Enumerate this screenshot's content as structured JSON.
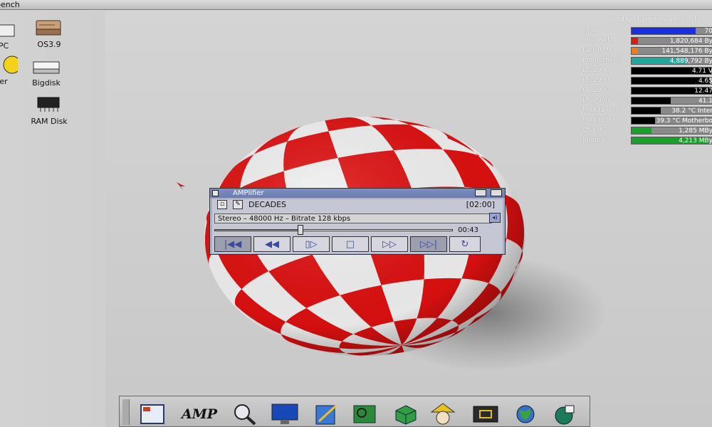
{
  "window_title": "bench",
  "desktop_icons": [
    {
      "label": "PC",
      "icon": "harddisk-icon"
    },
    {
      "label": "OS3.9",
      "icon": "harddisk-icon"
    },
    {
      "label": "er",
      "icon": "drive-icon"
    },
    {
      "label": "Bigdisk",
      "icon": "harddisk-icon"
    },
    {
      "label": "RAM Disk",
      "icon": "ramdisk-icon"
    }
  ],
  "monitor": {
    "date": "Sunday, 1 January 1978, 01",
    "rows": [
      {
        "label": "CPU",
        "value": "70",
        "fill": 0.76,
        "color": "#1830e0"
      },
      {
        "label": "Chip RAM",
        "value": "1,820,684 By",
        "fill": 0.08,
        "color": "#e01818"
      },
      {
        "label": "Fast RAM",
        "value": "141,548,176 By",
        "fill": 0.08,
        "color": "#f07a18"
      },
      {
        "label": "Prometheus",
        "value": "4,889,792 By",
        "fill": 0.64,
        "color": "#20a8a0"
      },
      {
        "label": "LTC2990",
        "value": "4.71 V",
        "fill": 0.95,
        "color": "#000000"
      },
      {
        "label": "LTC2990",
        "value": "4.65",
        "fill": 0.93,
        "color": "#000000"
      },
      {
        "label": "LTC2990",
        "value": "12.47",
        "fill": 0.96,
        "color": "#000000"
      },
      {
        "label": "LTC2990",
        "value": "41.1",
        "fill": 0.47,
        "color": "#000000"
      },
      {
        "label": "MAX31760",
        "value": "38.2 °C Inter",
        "fill": 0.35,
        "color": "#000000"
      },
      {
        "label": "MAX31760",
        "value": "39.3 °C Motherbo",
        "fill": 0.28,
        "color": "#000000"
      },
      {
        "label": "OS3.9:",
        "value": "1,285 MBy",
        "fill": 0.24,
        "color": "#18a028"
      },
      {
        "label": "Bigdisk:",
        "value": "4,213 MBy",
        "fill": 0.92,
        "color": "#18a028"
      }
    ]
  },
  "player": {
    "title": "AMPlifier",
    "song": "DECADES",
    "duration": "[02:00]",
    "info": "Stereo – 48000 Hz – Bitrate 128 kbps",
    "elapsed": "00:43",
    "progress": 0.36,
    "buttons": [
      "skip-back-icon",
      "rewind-icon",
      "pause-icon",
      "stop-icon",
      "fast-forward-icon",
      "skip-forward-icon",
      "repeat-icon"
    ]
  },
  "dock": {
    "amp_label": "AMP",
    "items": [
      "prefs-icon",
      "amp-logo",
      "search-icon",
      "monitor-icon",
      "notepad-icon",
      "circuit-icon",
      "cube-icon",
      "wizard-icon",
      "cdrom-icon",
      "globe-icon",
      "earth-usb-icon"
    ]
  }
}
